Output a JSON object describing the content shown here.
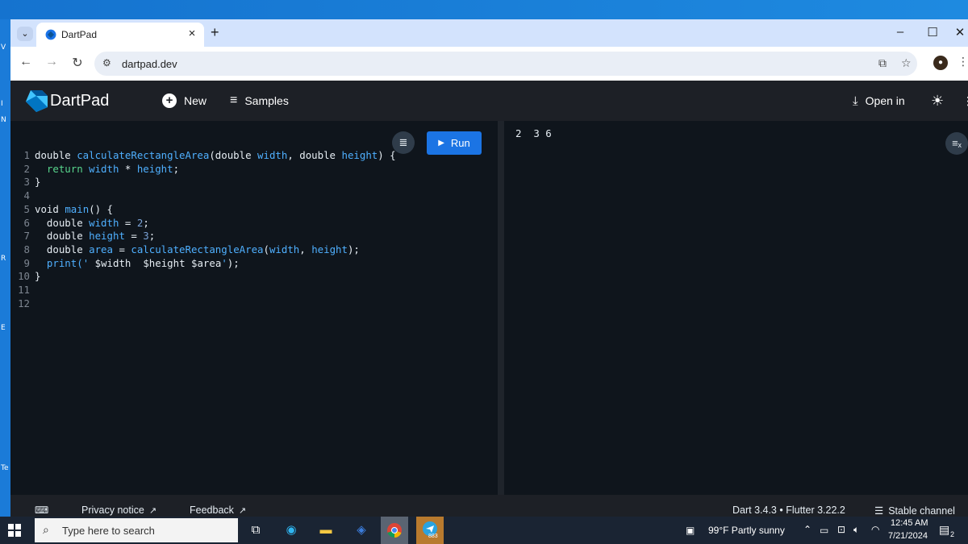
{
  "browser": {
    "tab_title": "DartPad",
    "tab_close": "×",
    "new_tab": "+",
    "url": "dartpad.dev",
    "window_controls": {
      "minimize": "–",
      "maximize": "☐",
      "close": "✕"
    }
  },
  "dartpad": {
    "title": "DartPad",
    "header": {
      "new_label": "New",
      "samples_label": "Samples",
      "open_in_label": "Open in"
    },
    "run_label": "Run",
    "code_lines": [
      {
        "n": "1",
        "tokens": [
          {
            "t": "double ",
            "c": "kw"
          },
          {
            "t": "calculateRectangleArea",
            "c": "fn"
          },
          {
            "t": "(double ",
            "c": "tx"
          },
          {
            "t": "width",
            "c": "vr"
          },
          {
            "t": ", double ",
            "c": "tx"
          },
          {
            "t": "height",
            "c": "vr"
          },
          {
            "t": ") {",
            "c": "tx"
          }
        ]
      },
      {
        "n": "2",
        "tokens": [
          {
            "t": "  ",
            "c": "tx"
          },
          {
            "t": "return ",
            "c": "ret"
          },
          {
            "t": "width",
            "c": "vr"
          },
          {
            "t": " * ",
            "c": "tx"
          },
          {
            "t": "height",
            "c": "vr"
          },
          {
            "t": ";",
            "c": "tx"
          }
        ]
      },
      {
        "n": "3",
        "tokens": [
          {
            "t": "}",
            "c": "tx"
          }
        ]
      },
      {
        "n": "4",
        "tokens": []
      },
      {
        "n": "5",
        "tokens": [
          {
            "t": "void ",
            "c": "kw"
          },
          {
            "t": "main",
            "c": "fn"
          },
          {
            "t": "() {",
            "c": "tx"
          }
        ]
      },
      {
        "n": "6",
        "tokens": [
          {
            "t": "  double ",
            "c": "tx"
          },
          {
            "t": "width",
            "c": "vr"
          },
          {
            "t": " = ",
            "c": "tx"
          },
          {
            "t": "2",
            "c": "nm"
          },
          {
            "t": ";",
            "c": "tx"
          }
        ]
      },
      {
        "n": "7",
        "tokens": [
          {
            "t": "  double ",
            "c": "tx"
          },
          {
            "t": "height",
            "c": "vr"
          },
          {
            "t": " = ",
            "c": "tx"
          },
          {
            "t": "3",
            "c": "nm"
          },
          {
            "t": ";",
            "c": "tx"
          }
        ]
      },
      {
        "n": "8",
        "tokens": [
          {
            "t": "  double ",
            "c": "tx"
          },
          {
            "t": "area",
            "c": "vr"
          },
          {
            "t": " = ",
            "c": "tx"
          },
          {
            "t": "calculateRectangleArea",
            "c": "fn"
          },
          {
            "t": "(",
            "c": "tx"
          },
          {
            "t": "width",
            "c": "vr"
          },
          {
            "t": ", ",
            "c": "tx"
          },
          {
            "t": "height",
            "c": "vr"
          },
          {
            "t": ");",
            "c": "tx"
          }
        ]
      },
      {
        "n": "9",
        "tokens": [
          {
            "t": "  ",
            "c": "tx"
          },
          {
            "t": "print",
            "c": "fn"
          },
          {
            "t": "(' ",
            "c": "str"
          },
          {
            "t": "$width",
            "c": "tx"
          },
          {
            "t": "  ",
            "c": "str"
          },
          {
            "t": "$height",
            "c": "tx"
          },
          {
            "t": " ",
            "c": "str"
          },
          {
            "t": "$area",
            "c": "tx"
          },
          {
            "t": "'",
            "c": "str"
          },
          {
            "t": ");",
            "c": "tx"
          }
        ]
      },
      {
        "n": "10",
        "tokens": [
          {
            "t": "}",
            "c": "tx"
          }
        ]
      },
      {
        "n": "11",
        "tokens": []
      },
      {
        "n": "12",
        "tokens": []
      }
    ],
    "console_output": "2  3 6",
    "footer": {
      "privacy": "Privacy notice",
      "feedback": "Feedback",
      "version": "Dart 3.4.3 • Flutter 3.22.2",
      "channel": "Stable channel"
    }
  },
  "taskbar": {
    "search_placeholder": "Type here to search",
    "weather": "99°F  Partly sunny",
    "time": "12:45 AM",
    "date": "7/21/2024",
    "notification_count": "2",
    "telegram_badge": "883"
  },
  "desktop_letters": [
    "V",
    "I",
    "N",
    "R",
    "E",
    "Te"
  ],
  "colors": {
    "accent": "#1b74e4",
    "editor_bg": "#0f151c",
    "header_bg": "#1d2026"
  }
}
